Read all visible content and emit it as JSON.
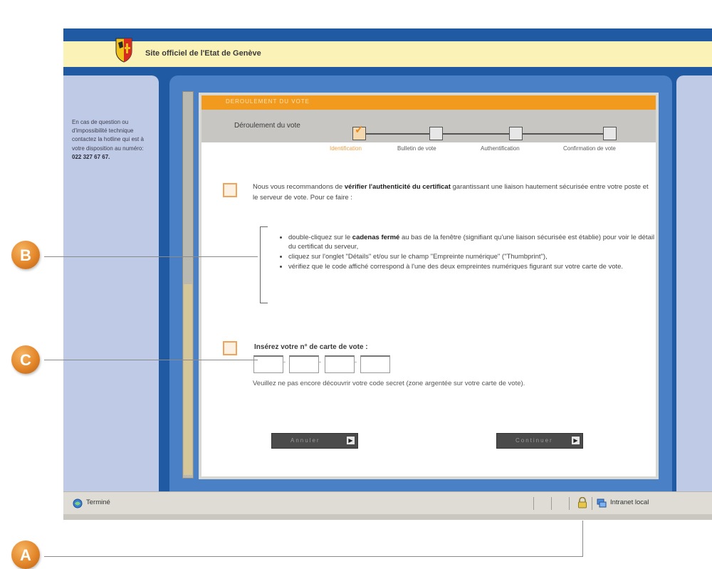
{
  "header": {
    "site_title": "Site officiel de l'Etat de Genève"
  },
  "sidebar": {
    "help_text": "En cas de question ou d'impossibilité technique contactez la hotline qui est à votre disposition au numéro:",
    "phone": "022 327 67 67."
  },
  "card": {
    "tab_label": "DEROULEMENT DU VOTE",
    "steps_title": "Déroulement du vote",
    "steps": [
      {
        "label": "Identification",
        "done": true
      },
      {
        "label": "Bulletin de vote",
        "done": false
      },
      {
        "label": "Authentification",
        "done": false
      },
      {
        "label": "Confirmation de vote",
        "done": false
      }
    ],
    "para1_start": "Nous vous recommandons de ",
    "para1_bold": "vérifier l'authenticité du certificat",
    "para1_end": " garantissant une liaison hautement sécurisée entre votre poste et le serveur de vote. Pour ce faire :",
    "bullets": [
      {
        "pre": "double-cliquez sur le ",
        "bold": "cadenas fermé",
        "post": " au bas de la fenêtre (signifiant qu'une liaison sécurisée est établie) pour voir le détail du certificat du serveur,"
      },
      {
        "pre": "cliquez sur l'onglet \"Détails\" et/ou sur le champ \"Empreinte numérique\" (\"Thumbprint\"),",
        "bold": "",
        "post": ""
      },
      {
        "pre": "vérifiez que le code affiché correspond à l'une des deux empreintes numériques figurant sur votre carte de vote.",
        "bold": "",
        "post": ""
      }
    ],
    "card_number_label": "Insérez votre n° de carte de vote :",
    "card_inputs": [
      "",
      "",
      "",
      ""
    ],
    "secret_note": "Veuillez ne pas encore découvrir votre code secret (zone argentée sur votre carte de vote).",
    "cancel_label": "Annuler",
    "continue_label": "Continuer"
  },
  "status_bar": {
    "status_text": "Terminé",
    "zone_text": "Intranet local"
  },
  "callouts": {
    "a": "A",
    "b": "B",
    "c": "C"
  },
  "colors": {
    "frame_blue": "#1f5aa2",
    "accent_orange": "#f19a1e",
    "panel_lavender": "#bfcae6"
  }
}
